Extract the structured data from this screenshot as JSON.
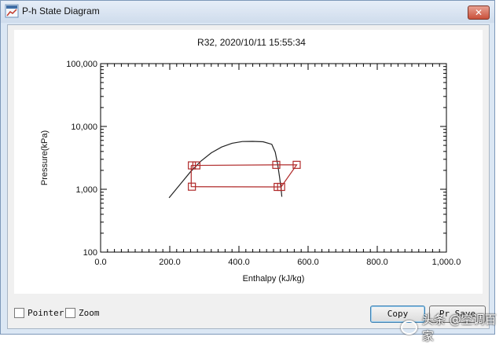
{
  "window": {
    "title": "P-h State Diagram",
    "close_glyph": "✕",
    "app_icon": "chart-app-icon"
  },
  "chart_data": {
    "type": "line",
    "title": "R32, 2020/10/11 15:55:34",
    "xlabel": "Enthalpy (kJ/kg)",
    "ylabel": "Pressure(kPa)",
    "xlim": [
      0,
      1000
    ],
    "ylim": [
      100,
      100000
    ],
    "yscale": "log",
    "x_ticks": [
      0,
      200,
      400,
      600,
      800,
      1000
    ],
    "x_tick_labels": [
      "0.0",
      "200.0",
      "400.0",
      "600.0",
      "800.0",
      "1,000.0"
    ],
    "y_ticks": [
      100,
      1000,
      10000,
      100000
    ],
    "y_tick_labels": [
      "100",
      "1,000",
      "10,000",
      "100,000"
    ],
    "grid": false,
    "saturation_dome": {
      "x": [
        198,
        230,
        260,
        290,
        320,
        350,
        380,
        410,
        440,
        470,
        495,
        505,
        512,
        518,
        522,
        524
      ],
      "y": [
        730,
        1200,
        1900,
        2800,
        3800,
        4700,
        5400,
        5750,
        5780,
        5700,
        5200,
        3900,
        2500,
        1500,
        1000,
        760
      ]
    },
    "cycle": {
      "x": [
        262,
        277,
        508,
        567,
        522,
        512,
        262,
        262
      ],
      "y": [
        2400,
        2400,
        2450,
        2450,
        1090,
        1090,
        1100,
        2400
      ]
    },
    "state_points": {
      "x": [
        264,
        277,
        508,
        567,
        522,
        512,
        264
      ],
      "y": [
        2400,
        2400,
        2450,
        2450,
        1090,
        1090,
        1100
      ]
    },
    "colors": {
      "dome": "#222222",
      "cycle": "#b02a2a"
    }
  },
  "controls": {
    "pointer_label": "Pointer",
    "zoom_label": "Zoom",
    "copy_label": "Copy",
    "other_label": "Pr Save"
  },
  "watermark": {
    "text": "头条 @空调百家"
  }
}
